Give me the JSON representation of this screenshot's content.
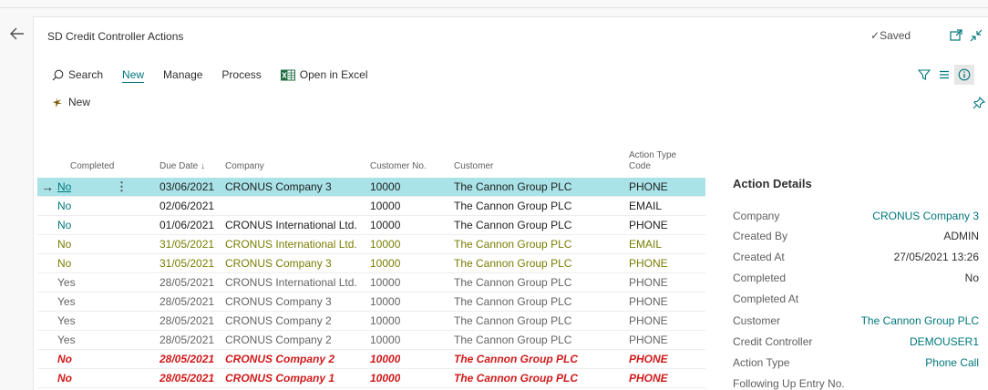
{
  "page": {
    "title": "SD Credit Controller Actions",
    "saved_label": "Saved"
  },
  "actionbar": {
    "search": "Search",
    "new": "New",
    "manage": "Manage",
    "process": "Process",
    "open_excel": "Open in Excel"
  },
  "subbar": {
    "new": "New"
  },
  "columns": {
    "completed": "Completed",
    "due_date": "Due Date ↓",
    "company": "Company",
    "customer_no": "Customer No.",
    "customer": "Customer",
    "action_type_1": "Action Type",
    "action_type_2": "Code"
  },
  "rows": [
    {
      "completed": "No",
      "due": "03/06/2021",
      "company": "CRONUS Company 3",
      "cust_no": "10000",
      "customer": "The Cannon Group PLC",
      "type": "PHONE"
    },
    {
      "completed": "No",
      "due": "02/06/2021",
      "company": "",
      "cust_no": "10000",
      "customer": "The Cannon Group PLC",
      "type": "EMAIL"
    },
    {
      "completed": "No",
      "due": "01/06/2021",
      "company": "CRONUS International Ltd.",
      "cust_no": "10000",
      "customer": "The Cannon Group PLC",
      "type": "PHONE"
    },
    {
      "completed": "No",
      "due": "31/05/2021",
      "company": "CRONUS International Ltd.",
      "cust_no": "10000",
      "customer": "The Cannon Group PLC",
      "type": "EMAIL"
    },
    {
      "completed": "No",
      "due": "31/05/2021",
      "company": "CRONUS Company 3",
      "cust_no": "10000",
      "customer": "The Cannon Group PLC",
      "type": "PHONE"
    },
    {
      "completed": "Yes",
      "due": "28/05/2021",
      "company": "CRONUS International Ltd.",
      "cust_no": "10000",
      "customer": "The Cannon Group PLC",
      "type": "PHONE"
    },
    {
      "completed": "Yes",
      "due": "28/05/2021",
      "company": "CRONUS Company 3",
      "cust_no": "10000",
      "customer": "The Cannon Group PLC",
      "type": "PHONE"
    },
    {
      "completed": "Yes",
      "due": "28/05/2021",
      "company": "CRONUS Company 2",
      "cust_no": "10000",
      "customer": "The Cannon Group PLC",
      "type": "PHONE"
    },
    {
      "completed": "Yes",
      "due": "28/05/2021",
      "company": "CRONUS Company 2",
      "cust_no": "10000",
      "customer": "The Cannon Group PLC",
      "type": "PHONE"
    },
    {
      "completed": "No",
      "due": "28/05/2021",
      "company": "CRONUS Company 2",
      "cust_no": "10000",
      "customer": "The Cannon Group PLC",
      "type": "PHONE"
    },
    {
      "completed": "No",
      "due": "28/05/2021",
      "company": "CRONUS Company 1",
      "cust_no": "10000",
      "customer": "The Cannon Group PLC",
      "type": "PHONE"
    }
  ],
  "details": {
    "title": "Action Details",
    "company_label": "Company",
    "company": "CRONUS Company 3",
    "created_by_label": "Created By",
    "created_by": "ADMIN",
    "created_at_label": "Created At",
    "created_at": "27/05/2021 13:26",
    "completed_label": "Completed",
    "completed": "No",
    "completed_at_label": "Completed At",
    "completed_at": "",
    "customer_label": "Customer",
    "customer": "The Cannon Group PLC",
    "credit_controller_label": "Credit Controller",
    "credit_controller": "DEMOUSER1",
    "action_type_label": "Action Type",
    "action_type": "Phone Call",
    "follow_up_label": "Following Up Entry No."
  },
  "colors": {
    "teal": "#00777b",
    "selected_row": "#a9e3e8",
    "olive": "#7a7d00",
    "red": "#d11a1a"
  }
}
